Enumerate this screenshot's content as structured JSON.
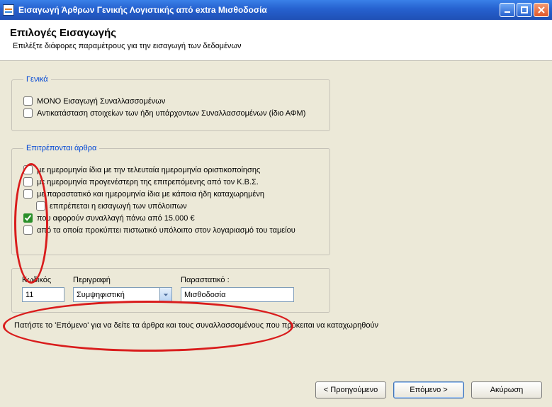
{
  "titlebar": {
    "title": "Εισαγωγή Άρθρων Γενικής Λογιστικής από extra Μισθοδοσία"
  },
  "header": {
    "title": "Επιλογές Εισαγωγής",
    "subtitle": "Επιλέξτε διάφορες παραμέτρους για την εισαγωγή των δεδομένων"
  },
  "group_general": {
    "legend": "Γενικά",
    "ck1": "ΜΟΝΟ Εισαγωγή Συναλλασσομένων",
    "ck2": "Αντικατάσταση στοιχείων των ήδη υπάρχοντων Συναλλασσομένων (ίδιο ΑΦΜ)"
  },
  "group_allowed": {
    "legend": "Επιτρέπονται άρθρα",
    "c1": "με ημερομηνία ίδια με την τελευταία ημερομηνία οριστικοποίησης",
    "c2": "με ημερομηνία προγενέστερη της επιτρεπόμενης από τον Κ.Β.Σ.",
    "c3": "με παραστατικό και ημερομηνία ίδια με κάποια ήδη καταχωρημένη",
    "c3a": "επιτρέπεται η εισαγωγή των υπόλοιπων",
    "c4": "που αφορούν συναλλαγή πάνω από 15.000 €",
    "c5": "από τα οποία προκύπτει πιστωτικό υπόλοιπο στον λογαριασμό του ταμείου"
  },
  "group_codes": {
    "code_label": "Κωδικός",
    "code_value": "11",
    "desc_label": "Περιγραφή",
    "desc_value": "Συμψηφιστική",
    "doc_label": "Παραστατικό :",
    "doc_value": "Μισθοδοσία"
  },
  "footer_hint": "Πατήστε το 'Επόμενο' για να δείτε τα άρθρα και τους συναλλασσομένους που πρόκειται να καταχωρηθούν",
  "buttons": {
    "prev": "< Προηγούμενο",
    "next": "Επόμενο >",
    "cancel": "Ακύρωση"
  }
}
